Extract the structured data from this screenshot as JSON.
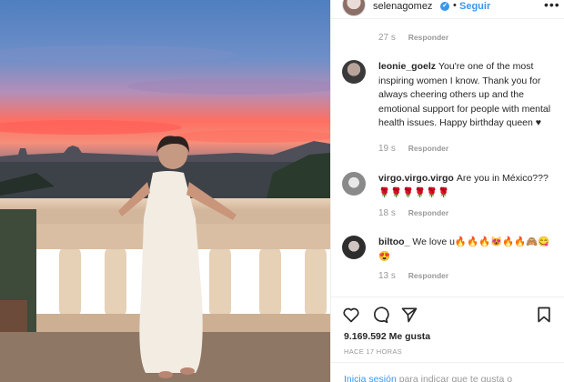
{
  "post": {
    "username": "selenagomez",
    "verified_badge": "✔",
    "separator": "•",
    "follow_label": "Seguir",
    "more_icon": "•••"
  },
  "comments": [
    {
      "time": "27 s",
      "reply_label": "Responder"
    },
    {
      "username": "leonie_goelz",
      "text": "You're one of the most inspiring women I know. Thank you for always cheering others up and the emotional support for people with mental health issues. Happy birthday queen ♥",
      "time": "19 s",
      "reply_label": "Responder"
    },
    {
      "username": "virgo.virgo.virgo",
      "text": "Are you in México??? 🌹🌹🌹🌹🌹🌹",
      "time": "18 s",
      "reply_label": "Responder"
    },
    {
      "username": "biltoo_",
      "text": "We love u🔥🔥🔥😻🔥🔥🙈😋😍",
      "time": "13 s",
      "reply_label": "Responder"
    }
  ],
  "actions": {
    "like_icon": "heart-icon",
    "comment_icon": "comment-icon",
    "share_icon": "share-icon",
    "save_icon": "bookmark-icon"
  },
  "likes": {
    "count": "9.169.592",
    "label": "Me gusta"
  },
  "time_ago": "HACE 17 HORAS",
  "footer": {
    "login_link": "Inicia sesión",
    "login_text": "para indicar que te gusta o"
  },
  "colors": {
    "accent": "#3897f0",
    "muted": "#999999",
    "text": "#262626"
  }
}
